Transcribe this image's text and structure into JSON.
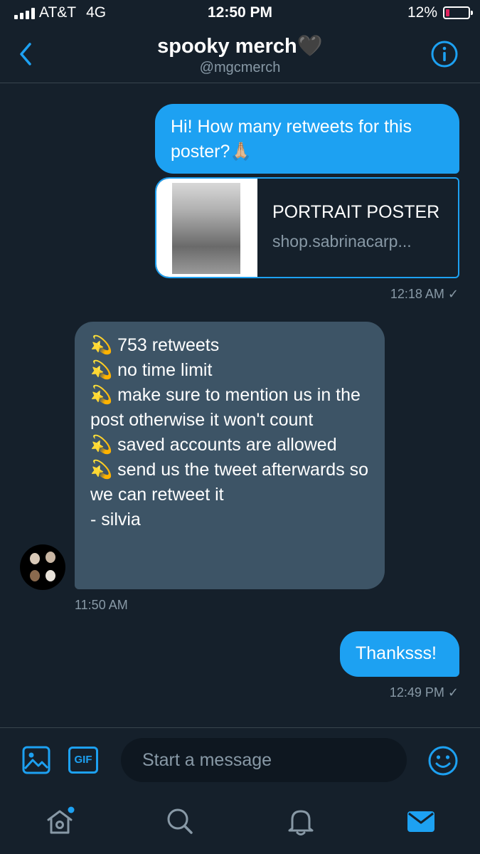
{
  "status_bar": {
    "carrier": "AT&T",
    "network": "4G",
    "time": "12:50 PM",
    "battery_pct": "12%",
    "battery_level": 0.12
  },
  "header": {
    "title": "spooky merch🖤",
    "handle": "@mgcmerch",
    "back_icon": "chevron-left-icon",
    "info_icon": "info-icon"
  },
  "messages": {
    "m1": {
      "text": "Hi! How many retweets for this poster?🙏🏼"
    },
    "card": {
      "title": "PORTRAIT POSTER",
      "url": "shop.sabrinacarp..."
    },
    "ts1": "12:18 AM ✓",
    "m2": {
      "lines": [
        "💫 753 retweets",
        "💫 no time limit",
        "💫 make sure to mention us in the post otherwise it won't count",
        "💫 saved accounts are allowed",
        "💫 send us the tweet afterwards so we can retweet it",
        "- silvia"
      ]
    },
    "ts2": "11:50 AM",
    "m3": {
      "text": "Thanksss!"
    },
    "ts3": "12:49 PM ✓"
  },
  "compose": {
    "placeholder": "Start a message",
    "gif_label": "GIF"
  },
  "colors": {
    "background": "#15202b",
    "accent": "#1da1f2",
    "incoming_bubble": "#3d5466",
    "muted": "#8899a6"
  },
  "tabs": [
    "home-icon",
    "search-icon",
    "notifications-icon",
    "messages-icon"
  ]
}
